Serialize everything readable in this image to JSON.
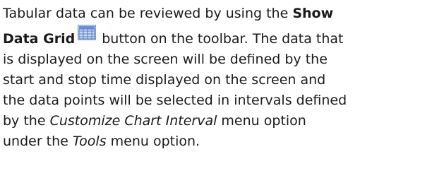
{
  "paragraph": {
    "line1": {
      "text": "Tabular data can be reviewed by using the ",
      "bold": "Show"
    },
    "line2": {
      "bold": "Data Grid",
      "icon": "data-grid-icon",
      "text": " button on the toolbar.  The data that"
    },
    "line3": {
      "text": "is displayed on the screen will be defined by the"
    },
    "line4": {
      "text": "start and stop time displayed on the screen and"
    },
    "line5": {
      "text": "the data points will be selected in intervals defined"
    },
    "line6": {
      "prefix": "by the ",
      "italic": "Customize Chart Interval",
      "suffix": " menu option"
    },
    "line7": {
      "prefix": "under the ",
      "italic": "Tools",
      "suffix": " menu option."
    }
  }
}
